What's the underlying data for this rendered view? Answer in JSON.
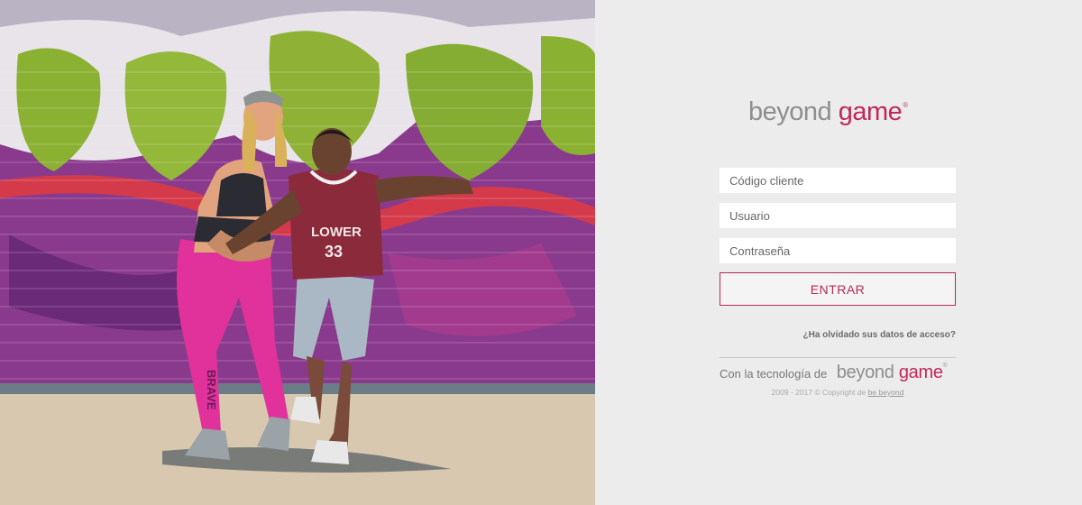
{
  "logo": {
    "word1": "beyond",
    "word2": "game",
    "mark": "®"
  },
  "form": {
    "client_placeholder": "Código cliente",
    "user_placeholder": "Usuario",
    "password_placeholder": "Contraseña",
    "submit_label": "ENTRAR"
  },
  "forgot_link": "¿Ha olvidado sus datos de acceso?",
  "footer": {
    "tech_label": "Con la tecnología de",
    "brand_word1": "beyond",
    "brand_word2": "game",
    "brand_mark": "®",
    "copyright_text": "2009 - 2017 © Copyright de",
    "copyright_link": "be beyond"
  },
  "hero": {
    "graffiti_text": "LOWER",
    "jersey_number": "33",
    "legging_text": "BRAVE"
  },
  "colors": {
    "accent": "#c2275a",
    "button_border": "#b52a56",
    "panel_bg": "#ececec",
    "logo_grey": "#8e8e8e"
  }
}
